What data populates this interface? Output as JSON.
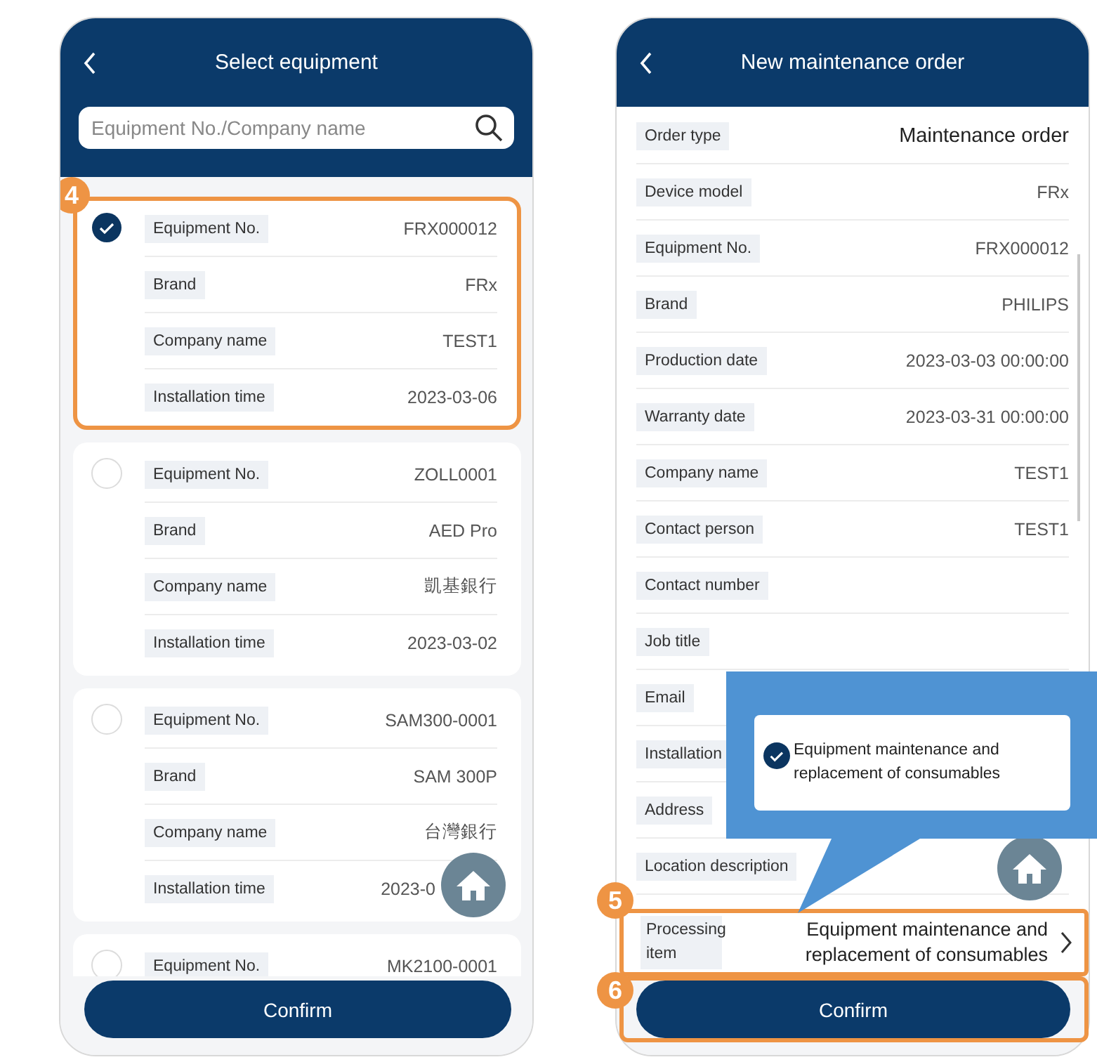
{
  "screens": [
    {
      "kind": "equipment_list",
      "title": "Select equipment",
      "search": {
        "placeholder": "Equipment No./Company name"
      },
      "items": [
        {
          "selected": true,
          "step": "4",
          "fields": [
            {
              "label": "Equipment No.",
              "value": "FRX000012"
            },
            {
              "label": "Brand",
              "value": "FRx"
            },
            {
              "label": "Company name",
              "value": "TEST1"
            },
            {
              "label": "Installation time",
              "value": "2023-03-06"
            }
          ]
        },
        {
          "selected": false,
          "fields": [
            {
              "label": "Equipment No.",
              "value": "ZOLL0001"
            },
            {
              "label": "Brand",
              "value": "AED Pro"
            },
            {
              "label": "Company name",
              "value": "凱基銀行"
            },
            {
              "label": "Installation time",
              "value": "2023-03-02"
            }
          ]
        },
        {
          "selected": false,
          "fields": [
            {
              "label": "Equipment No.",
              "value": "SAM300-0001"
            },
            {
              "label": "Brand",
              "value": "SAM 300P"
            },
            {
              "label": "Company name",
              "value": "台灣銀行"
            },
            {
              "label": "Installation time",
              "value": "2023-0"
            }
          ]
        },
        {
          "selected": false,
          "fields": [
            {
              "label": "Equipment No.",
              "value": "MK2100-0001"
            }
          ]
        }
      ],
      "confirm": {
        "label": "Confirm"
      }
    },
    {
      "kind": "order_form",
      "title": "New maintenance order",
      "fields": [
        {
          "label": "Order type",
          "value": "Maintenance order"
        },
        {
          "label": "Device model",
          "value": "FRx"
        },
        {
          "label": "Equipment No.",
          "value": "FRX000012"
        },
        {
          "label": "Brand",
          "value": "PHILIPS"
        },
        {
          "label": "Production date",
          "value": "2023-03-03 00:00:00"
        },
        {
          "label": "Warranty date",
          "value": "2023-03-31 00:00:00"
        },
        {
          "label": "Company name",
          "value": "TEST1"
        },
        {
          "label": "Contact person",
          "value": "TEST1"
        },
        {
          "label": "Contact number"
        },
        {
          "label": "Job title"
        },
        {
          "label": "Email"
        },
        {
          "label": "Installation"
        },
        {
          "label": "Address"
        },
        {
          "label": "Location description"
        }
      ],
      "processing_item": {
        "label": "Processing item",
        "value": "Equipment maintenance and replacement of consumables",
        "step": "5"
      },
      "confirm": {
        "label": "Confirm",
        "step": "6"
      },
      "popup": {
        "options": [
          {
            "checked": true,
            "text": "Equipment maintenance and replacement of consumables"
          }
        ]
      }
    }
  ]
}
